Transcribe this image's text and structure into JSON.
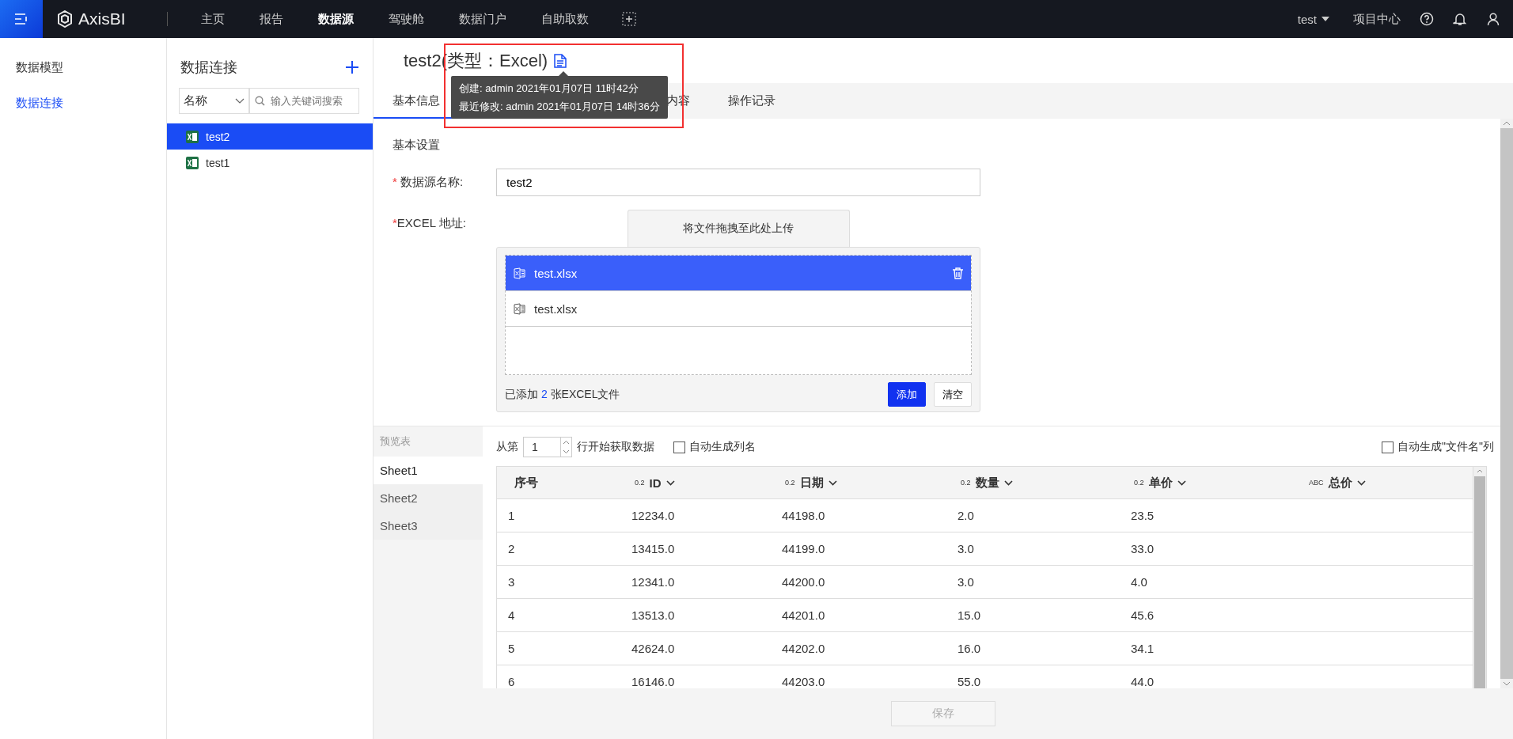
{
  "topbar": {
    "logo": "AxisBI",
    "nav": [
      {
        "label": "主页",
        "selected": false
      },
      {
        "label": "报告",
        "selected": false
      },
      {
        "label": "数据源",
        "selected": true
      },
      {
        "label": "驾驶舱",
        "selected": false
      },
      {
        "label": "数据门户",
        "selected": false
      },
      {
        "label": "自助取数",
        "selected": false
      }
    ],
    "user": "test",
    "project_center": "项目中心"
  },
  "sidebar": {
    "items": [
      {
        "label": "数据模型",
        "selected": false
      },
      {
        "label": "数据连接",
        "selected": true
      }
    ]
  },
  "connections": {
    "title": "数据连接",
    "filter": "名称",
    "search": {
      "placeholder": "输入关键词搜索"
    },
    "items": [
      {
        "label": "test2",
        "selected": true
      },
      {
        "label": "test1",
        "selected": false
      }
    ]
  },
  "main": {
    "title": "test2(类型：Excel)",
    "tooltip": [
      "创建: admin 2021年01月07日 11时42分",
      "最近修改: admin 2021年01月07日 14时36分"
    ],
    "tabs": [
      {
        "label": "基本信息",
        "selected": true
      },
      {
        "label": "内容",
        "selected": false
      },
      {
        "label": "操作记录",
        "selected": false
      }
    ],
    "section_title": "基本设置",
    "name_label": "数据源名称:",
    "name_value": "test2",
    "excel_label": "EXCEL 地址:",
    "required_mark": "*",
    "upload": "将文件拖拽至此处上传",
    "files": [
      {
        "name": "test.xlsx",
        "selected": true
      },
      {
        "name": "test.xlsx",
        "selected": false
      }
    ],
    "files_summary": "已添加 **2** 张EXCEL文件",
    "add_button": "添加",
    "clear_button": "清空",
    "preview": {
      "title": "预览表",
      "sheets": [
        {
          "label": "Sheet1",
          "selected": true
        },
        {
          "label": "Sheet2",
          "selected": false
        },
        {
          "label": "Sheet3",
          "selected": false
        }
      ],
      "start_prefix": "从第",
      "start_row": "1",
      "start_suffix": "行开始获取数据",
      "auto_columns": {
        "label": "自动生成列名",
        "checked": false
      },
      "auto_filename": {
        "label": "自动生成\"文件名\"列",
        "checked": false
      },
      "columns": [
        {
          "label": "序号"
        },
        {
          "type": "0.2",
          "label": "ID"
        },
        {
          "type": "0.2",
          "label": "日期"
        },
        {
          "type": "0.2",
          "label": "数量"
        },
        {
          "type": "0.2",
          "label": "单价"
        },
        {
          "type": "ABC",
          "label": "总价"
        }
      ],
      "rows": [
        [
          "1",
          "12234.0",
          "44198.0",
          "2.0",
          "23.5"
        ],
        [
          "2",
          "13415.0",
          "44199.0",
          "3.0",
          "33.0"
        ],
        [
          "3",
          "12341.0",
          "44200.0",
          "3.0",
          "4.0"
        ],
        [
          "4",
          "13513.0",
          "44201.0",
          "15.0",
          "45.6"
        ],
        [
          "5",
          "42624.0",
          "44202.0",
          "16.0",
          "34.1"
        ],
        [
          "6",
          "16146.0",
          "44203.0",
          "55.0",
          "44.0"
        ]
      ]
    },
    "save": {
      "label": "保存",
      "disabled": true
    }
  }
}
